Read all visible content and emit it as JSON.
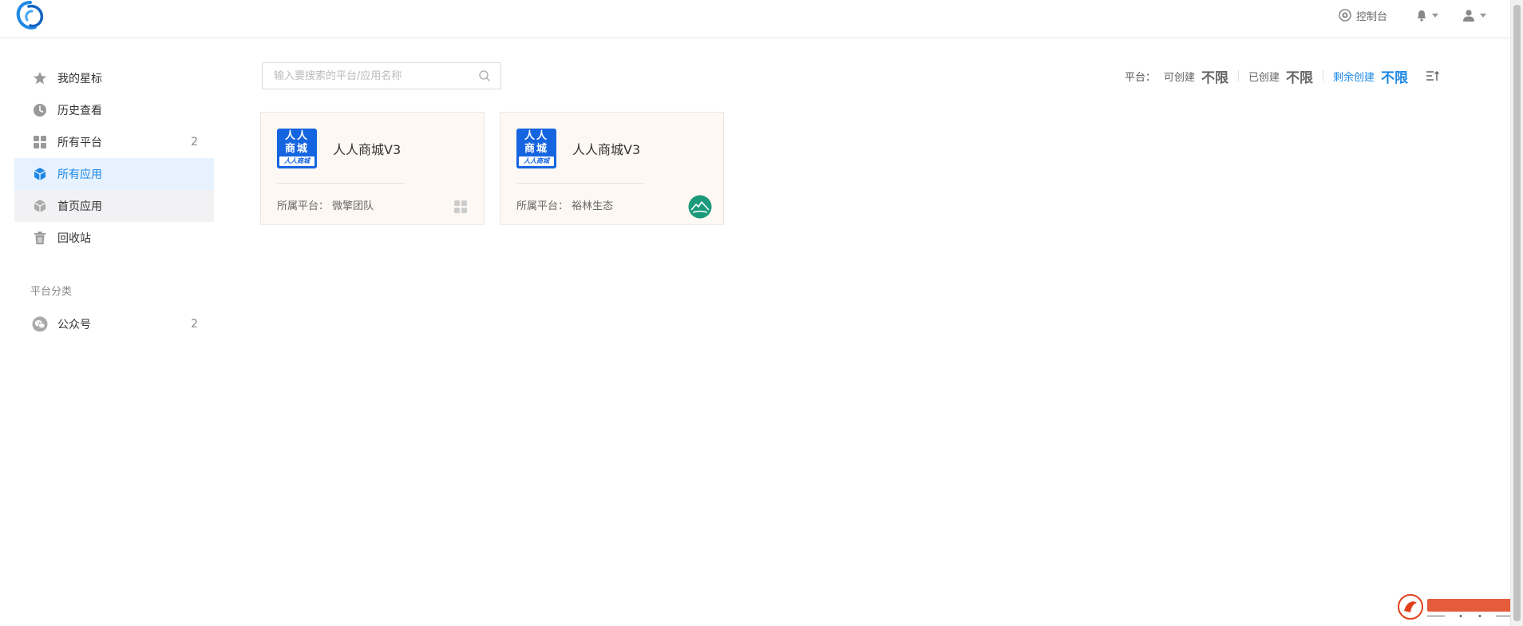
{
  "header": {
    "console_label": "控制台"
  },
  "sidebar": {
    "items": [
      {
        "label": "我的星标",
        "count": "",
        "icon": "star-icon"
      },
      {
        "label": "历史查看",
        "count": "",
        "icon": "clock-icon"
      },
      {
        "label": "所有平台",
        "count": "2",
        "icon": "grid-icon"
      },
      {
        "label": "所有应用",
        "count": "",
        "icon": "cube-icon"
      },
      {
        "label": "首页应用",
        "count": "",
        "icon": "cube-icon"
      },
      {
        "label": "回收站",
        "count": "",
        "icon": "trash-icon"
      }
    ],
    "section_title": "平台分类",
    "categories": [
      {
        "label": "公众号",
        "count": "2",
        "icon": "wechat-icon"
      }
    ]
  },
  "search": {
    "placeholder": "输入要搜索的平台/应用名称"
  },
  "stats": {
    "platform_label": "平台：",
    "can_create_label": "可创建",
    "can_create_value": "不限",
    "created_label": "已创建",
    "created_value": "不限",
    "remaining_label": "剩余创建",
    "remaining_value": "不限"
  },
  "cards": [
    {
      "icon_line1": "人人",
      "icon_line2": "商城",
      "icon_band": "人人商城",
      "name": "人人商城V3",
      "platform_label": "所属平台：",
      "platform_name": "微擎团队"
    },
    {
      "icon_line1": "人人",
      "icon_line2": "商城",
      "icon_band": "人人商城",
      "name": "人人商城V3",
      "platform_label": "所属平台：",
      "platform_name": "裕林生态"
    }
  ],
  "colors": {
    "accent": "#1e88e5",
    "active_bg": "#e6f2ff",
    "card_bg": "#fdf8f3",
    "app_icon_blue": "#1565e0",
    "platform_green": "#1a9a7a"
  }
}
